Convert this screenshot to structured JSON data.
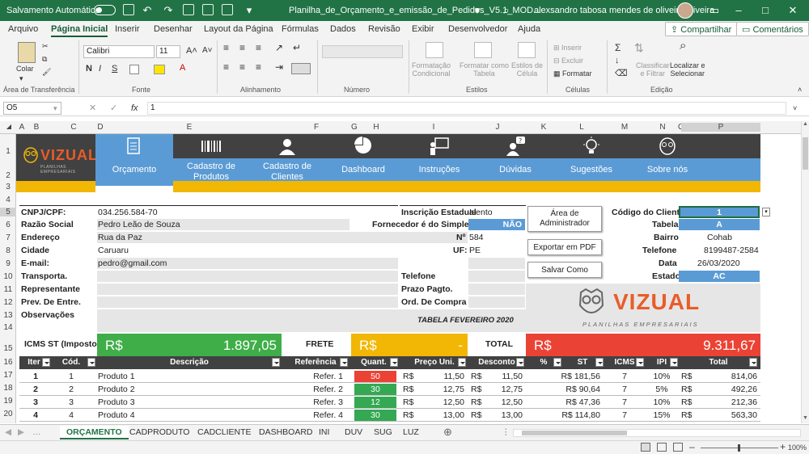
{
  "titlebar": {
    "autosave": "Salvamento Automático",
    "filename": "Planilha_de_Orçamento_e_emissão_de_Pedidos_V5.1_MOD...",
    "user": "alexsandro tabosa mendes de oliveira oliveira",
    "color": "#217346"
  },
  "menu": {
    "tabs": [
      "Arquivo",
      "Página Inicial",
      "Inserir",
      "Desenhar",
      "Layout da Página",
      "Fórmulas",
      "Dados",
      "Revisão",
      "Exibir",
      "Desenvolvedor",
      "Ajuda"
    ],
    "share": "Compartilhar",
    "comments": "Comentários"
  },
  "ribbon": {
    "paste": "Colar",
    "font": "Calibri",
    "size": "11",
    "bold": "N",
    "italic": "I",
    "underline": "S",
    "groups": [
      "Área de Transferência",
      "Fonte",
      "Alinhamento",
      "Número",
      "Estilos",
      "Células",
      "Edição"
    ],
    "cond_format": "Formatação\nCondicional",
    "format_table": "Formatar como\nTabela",
    "cell_styles": "Estilos de\nCélula",
    "insert": "Inserir",
    "delete": "Excluir",
    "format": "Formatar",
    "sort": "Classificar\ne Filtrar",
    "find": "Localizar e\nSelecionar"
  },
  "formula_bar": {
    "namebox": "O5",
    "fx": "fx",
    "value": "1"
  },
  "columns": [
    "A",
    "B",
    "C",
    "D",
    "E",
    "F",
    "G",
    "H",
    "I",
    "J",
    "K",
    "L",
    "M",
    "N",
    "O",
    "P"
  ],
  "rows": [
    "1",
    "2",
    "3",
    "4",
    "5",
    "6",
    "7",
    "8",
    "9",
    "10",
    "11",
    "12",
    "13",
    "14",
    "15",
    "16",
    "17",
    "18",
    "19",
    "20"
  ],
  "logo": {
    "brand": "VIZUAL",
    "tagline": "PLANILHAS EMPRESARIAIS"
  },
  "nav": [
    {
      "label": "Orçamento",
      "icon": "document-icon"
    },
    {
      "label": "Cadastro de\nProdutos",
      "icon": "barcode-icon"
    },
    {
      "label": "Cadastro de\nClientes",
      "icon": "user-icon"
    },
    {
      "label": "Dashboard",
      "icon": "pie-chart-icon"
    },
    {
      "label": "Instruções",
      "icon": "presentation-icon"
    },
    {
      "label": "Dúvidas",
      "icon": "question-person-icon"
    },
    {
      "label": "Sugestões",
      "icon": "lightbulb-icon"
    },
    {
      "label": "Sobre nós",
      "icon": "owl-icon"
    }
  ],
  "client": {
    "labels": [
      "CNPJ/CPF:",
      "Razão Social",
      "Endereço",
      "Cidade",
      "E-mail:",
      "Transporta.",
      "Representante",
      "Prev. De Entre.",
      "Observações"
    ],
    "values": [
      "034.256.584-70",
      "Pedro Leão de Souza",
      "Rua da Paz",
      "Caruaru",
      "pedro@gmail.com"
    ]
  },
  "mid": {
    "ie_label": "Inscrição Estadual",
    "ie_value": "Isento",
    "simples_label": "Fornecedor é do Simples?",
    "simples_value": "NÃO",
    "num_label": "Nº",
    "num_value": "584",
    "uf_label": "UF:",
    "uf_value": "PE",
    "phone_label": "Telefone",
    "term_label": "Prazo Pagto.",
    "order_label": "Ord. De Compra",
    "price_table": "TABELA FEVEREIRO 2020"
  },
  "buttons": {
    "admin": "Área de\nAdministrador",
    "pdf": "Exportar em PDF",
    "saveas": "Salvar Como"
  },
  "right": {
    "labels": [
      "Código do Cliente",
      "Tabela",
      "Bairro",
      "Telefone",
      "Data",
      "Estado"
    ],
    "values": [
      "1",
      "A",
      "Cohab",
      "8199487-2584",
      "26/03/2020",
      "AC"
    ]
  },
  "totals": {
    "icms_label": "ICMS ST (Imposto)",
    "icms_currency": "R$",
    "icms_value": "1.897,05",
    "frete_label": "FRETE",
    "frete_currency": "R$",
    "frete_value": "-",
    "total_label": "TOTAL",
    "total_currency": "R$",
    "total_value": "9.311,67"
  },
  "table": {
    "headers": [
      "Iter",
      "Cód.",
      "Descrição",
      "Referência",
      "Quant.",
      "Preço Uni.",
      "Desconto",
      "%",
      "ST",
      "ICMS",
      "IPI",
      "Total"
    ],
    "rows": [
      {
        "item": "1",
        "cod": "1",
        "desc": "Produto 1",
        "ref": "Refer. 1",
        "qty": "50",
        "qtycolor": "#ea4335",
        "cur1": "R$",
        "price": "11,50",
        "cur2": "R$",
        "disc": "11,50",
        "st": "R$ 181,56",
        "icms": "7",
        "ipi": "10%",
        "cur3": "R$",
        "total": "814,06"
      },
      {
        "item": "2",
        "cod": "2",
        "desc": "Produto 2",
        "ref": "Refer. 2",
        "qty": "30",
        "qtycolor": "#34a853",
        "cur1": "R$",
        "price": "12,75",
        "cur2": "R$",
        "disc": "12,75",
        "st": "R$ 90,64",
        "icms": "7",
        "ipi": "5%",
        "cur3": "R$",
        "total": "492,26"
      },
      {
        "item": "3",
        "cod": "3",
        "desc": "Produto 3",
        "ref": "Refer. 3",
        "qty": "12",
        "qtycolor": "#34a853",
        "cur1": "R$",
        "price": "12,50",
        "cur2": "R$",
        "disc": "12,50",
        "st": "R$ 47,36",
        "icms": "7",
        "ipi": "10%",
        "cur3": "R$",
        "total": "212,36"
      },
      {
        "item": "4",
        "cod": "4",
        "desc": "Produto 4",
        "ref": "Refer. 4",
        "qty": "30",
        "qtycolor": "#34a853",
        "cur1": "R$",
        "price": "13,00",
        "cur2": "R$",
        "disc": "13,00",
        "st": "R$ 114,80",
        "icms": "7",
        "ipi": "15%",
        "cur3": "R$",
        "total": "563,30"
      }
    ]
  },
  "sheet_tabs": [
    "ORÇAMENTO",
    "CADPRODUTO",
    "CADCLIENTE",
    "DASHBOARD",
    "INI",
    "DUV",
    "SUG",
    "LUZ"
  ],
  "status": {
    "zoom": "100%"
  },
  "colors": {
    "dark": "#414141",
    "blue": "#5b9bd5",
    "yellow": "#f2b705",
    "green": "#3fae49",
    "red": "#ea4335",
    "orange": "#e85d2a"
  }
}
